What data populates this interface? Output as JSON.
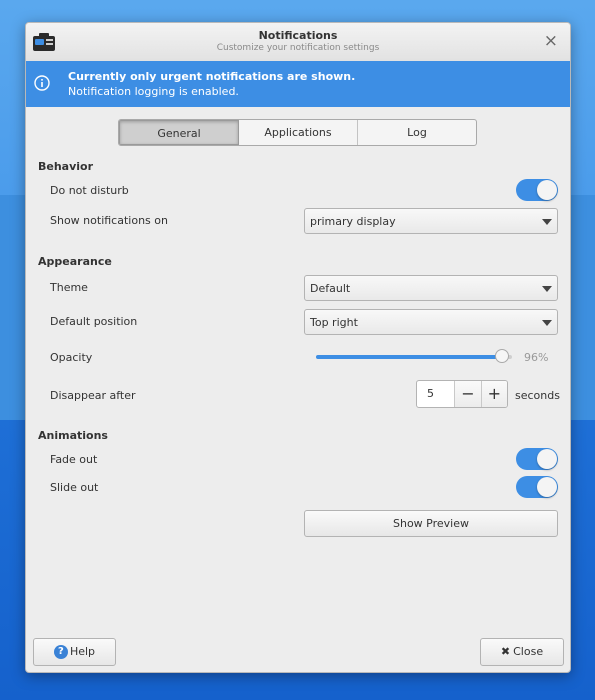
{
  "window": {
    "title": "Notifications",
    "subtitle": "Customize your notification settings",
    "close_glyph": "×",
    "icon": "notification-app-icon"
  },
  "infobar": {
    "line1": "Currently only urgent notifications are shown.",
    "line2": "Notification logging is enabled.",
    "icon": "info-icon"
  },
  "tabs": [
    {
      "label": "General",
      "active": true
    },
    {
      "label": "Applications",
      "active": false
    },
    {
      "label": "Log",
      "active": false
    }
  ],
  "behavior": {
    "heading": "Behavior",
    "do_not_disturb": {
      "label": "Do not disturb",
      "on": true
    },
    "show_on": {
      "label": "Show notifications on",
      "value": "primary display"
    }
  },
  "appearance": {
    "heading": "Appearance",
    "theme": {
      "label": "Theme",
      "value": "Default"
    },
    "position": {
      "label": "Default position",
      "value": "Top right"
    },
    "opacity": {
      "label": "Opacity",
      "value": 96,
      "display": "96%"
    },
    "disappear": {
      "label": "Disappear after",
      "value": "5",
      "minus": "−",
      "plus": "+",
      "unit": "seconds"
    }
  },
  "animations": {
    "heading": "Animations",
    "fade_out": {
      "label": "Fade out",
      "on": true
    },
    "slide_out": {
      "label": "Slide out",
      "on": true
    }
  },
  "buttons": {
    "preview": "Show Preview",
    "help": "Help",
    "help_glyph": "?",
    "close": "Close",
    "close_glyph": "✖"
  },
  "colors": {
    "accent": "#3d8ee4",
    "window_bg": "#ededed"
  }
}
